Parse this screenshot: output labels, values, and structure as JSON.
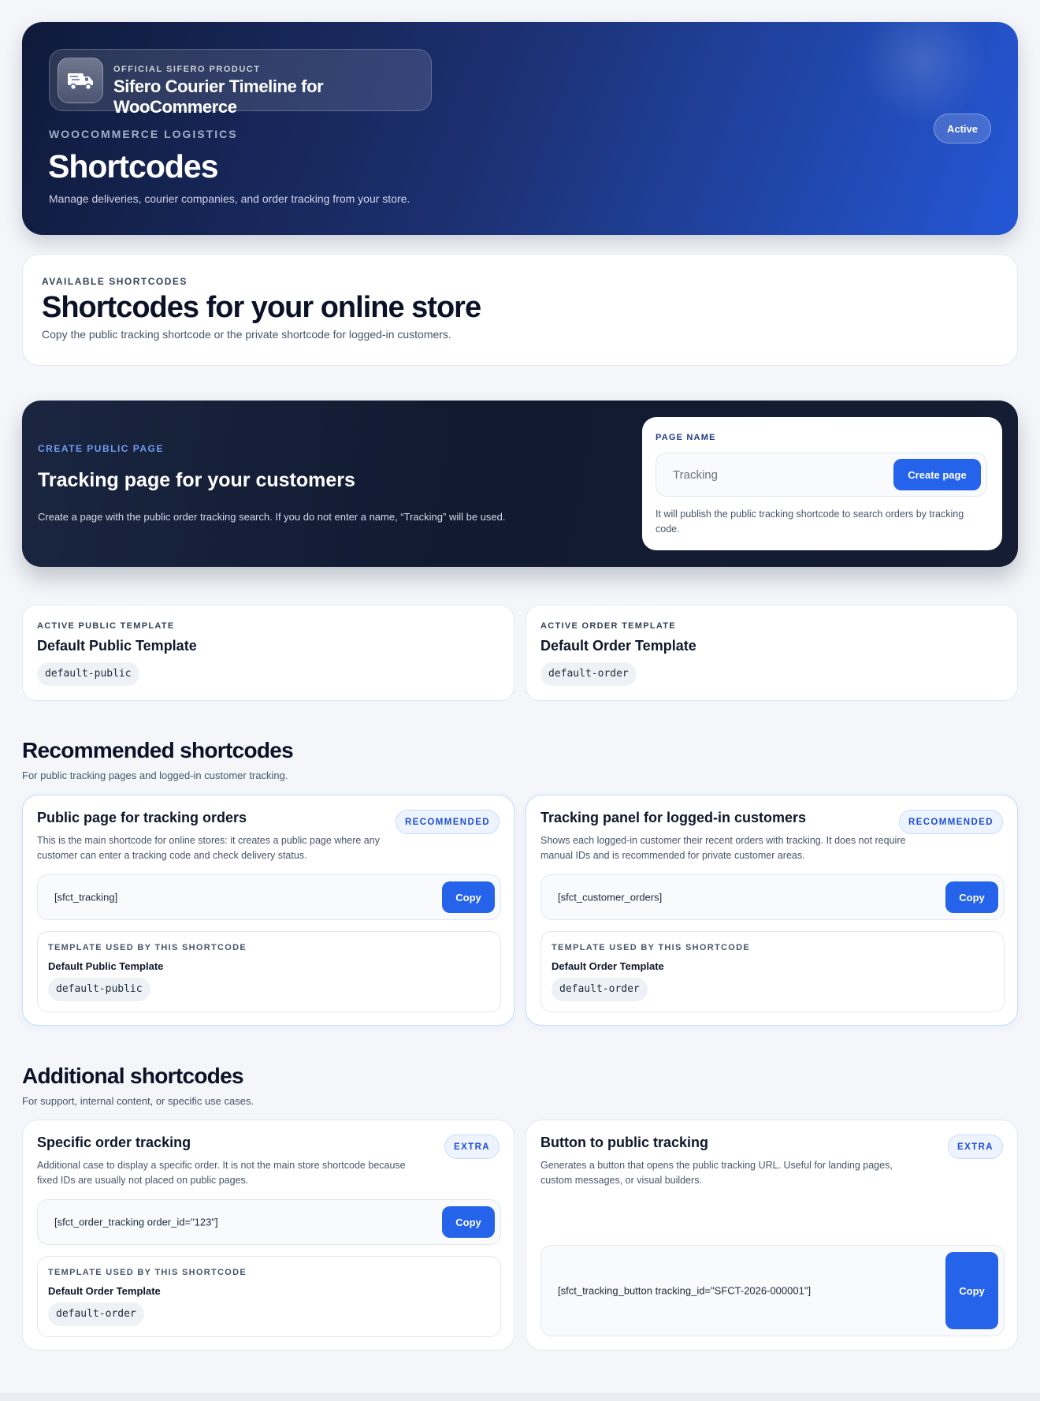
{
  "hero": {
    "brand_kicker": "OFFICIAL SIFERO PRODUCT",
    "brand_name": "Sifero Courier Timeline for WooCommerce",
    "brand_icon": "delivery-truck-icon",
    "eyebrow": "WOOCOMMERCE LOGISTICS",
    "title": "Shortcodes",
    "subtitle": "Manage deliveries, courier companies, and order tracking from your store.",
    "status": "Active"
  },
  "intro": {
    "eyebrow": "AVAILABLE SHORTCODES",
    "title": "Shortcodes for your online store",
    "description": "Copy the public tracking shortcode or the private shortcode for logged-in customers."
  },
  "create_page": {
    "eyebrow": "CREATE PUBLIC PAGE",
    "title": "Tracking page for your customers",
    "description": "Create a page with the public order tracking search. If you do not enter a name, “Tracking” will be used.",
    "field_label": "PAGE NAME",
    "placeholder": "Tracking",
    "button_label": "Create page",
    "help": "It will publish the public tracking shortcode to search orders by tracking code."
  },
  "active_templates": [
    {
      "eyebrow": "ACTIVE PUBLIC TEMPLATE",
      "name": "Default Public Template",
      "slug": "default-public"
    },
    {
      "eyebrow": "ACTIVE ORDER TEMPLATE",
      "name": "Default Order Template",
      "slug": "default-order"
    }
  ],
  "recommended": {
    "title": "Recommended shortcodes",
    "subtitle": "For public tracking pages and logged-in customer tracking.",
    "cards": [
      {
        "title": "Public page for tracking orders",
        "badge": "RECOMMENDED",
        "description": "This is the main shortcode for online stores: it creates a public page where any customer can enter a tracking code and check delivery status.",
        "shortcode": "[sfct_tracking]",
        "copy_label": "Copy",
        "template_eyebrow": "TEMPLATE USED BY THIS SHORTCODE",
        "template_name": "Default Public Template",
        "template_slug": "default-public"
      },
      {
        "title": "Tracking panel for logged-in customers",
        "badge": "RECOMMENDED",
        "description": "Shows each logged-in customer their recent orders with tracking. It does not require manual IDs and is recommended for private customer areas.",
        "shortcode": "[sfct_customer_orders]",
        "copy_label": "Copy",
        "template_eyebrow": "TEMPLATE USED BY THIS SHORTCODE",
        "template_name": "Default Order Template",
        "template_slug": "default-order"
      }
    ]
  },
  "additional": {
    "title": "Additional shortcodes",
    "subtitle": "For support, internal content, or specific use cases.",
    "cards": [
      {
        "title": "Specific order tracking",
        "badge": "EXTRA",
        "description": "Additional case to display a specific order. It is not the main store shortcode because fixed IDs are usually not placed on public pages.",
        "shortcode": "[sfct_order_tracking order_id=\"123\"]",
        "copy_label": "Copy",
        "template_eyebrow": "TEMPLATE USED BY THIS SHORTCODE",
        "template_name": "Default Order Template",
        "template_slug": "default-order"
      },
      {
        "title": "Button to public tracking",
        "badge": "EXTRA",
        "description": "Generates a button that opens the public tracking URL. Useful for landing pages, custom messages, or visual builders.",
        "shortcode": "[sfct_tracking_button tracking_id=\"SFCT-2026-000001\"]",
        "copy_label": "Copy"
      }
    ]
  }
}
